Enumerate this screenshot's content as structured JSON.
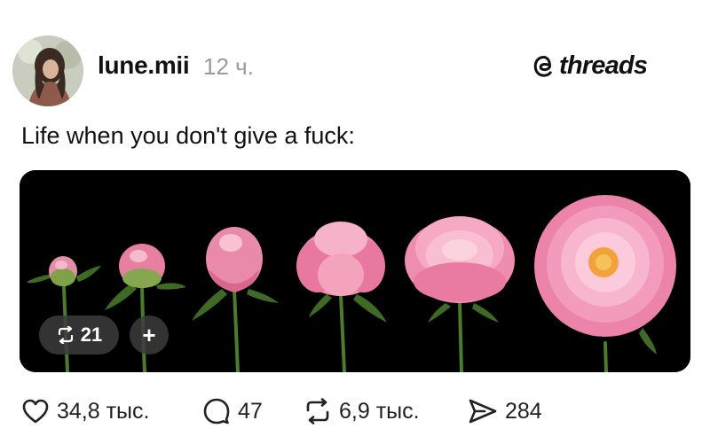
{
  "post": {
    "username": "lune.mii",
    "timestamp": "12 ч.",
    "brand": "threads",
    "text": "Life when you don't give a fuck:"
  },
  "media": {
    "repost_count": "21",
    "add_label": "+"
  },
  "actions": {
    "likes": "34,8 тыс.",
    "comments": "47",
    "reposts": "6,9 тыс.",
    "shares": "284"
  }
}
